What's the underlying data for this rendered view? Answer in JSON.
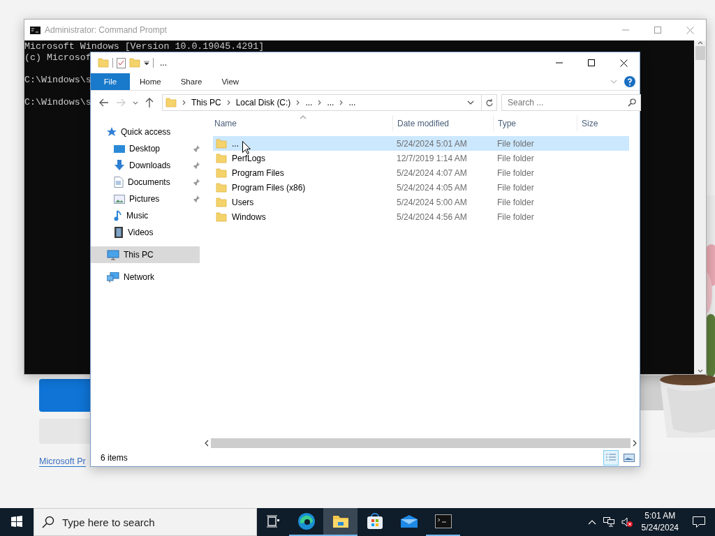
{
  "desktop": {
    "link": "Microsoft Pr"
  },
  "cmd_window": {
    "title": "Administrator: Command Prompt",
    "active": false,
    "lines": [
      {
        "text": "Microsoft Windows [Version 10.0.19045.4291]",
        "blank_before": false
      },
      {
        "text": "(c) Microsof",
        "blank_before": false
      },
      {
        "text": "C:\\Windows\\s",
        "blank_before": true
      },
      {
        "text": "C:\\Windows\\s",
        "blank_before": true
      }
    ]
  },
  "explorer": {
    "active": true,
    "quick_access_toolbar": {
      "text": "..."
    },
    "ribbon_tabs": [
      {
        "label": "File",
        "kind": "menu",
        "selected": false
      },
      {
        "label": "Home",
        "kind": "tab",
        "selected": false
      },
      {
        "label": "Share",
        "kind": "tab",
        "selected": false
      },
      {
        "label": "View",
        "kind": "tab",
        "selected": false
      }
    ],
    "address": {
      "segments": [
        "This PC",
        "Local Disk (C:)",
        "...",
        "...",
        "..."
      ]
    },
    "search": {
      "placeholder": "Search ..."
    },
    "nav": [
      {
        "label": "Quick access",
        "kind": "star",
        "selected": false,
        "pinned": false,
        "children": [
          {
            "label": "Desktop",
            "kind": "desktop",
            "selected": false,
            "pinned": true
          },
          {
            "label": "Downloads",
            "kind": "downloads",
            "selected": false,
            "pinned": true
          },
          {
            "label": "Documents",
            "kind": "documents",
            "selected": false,
            "pinned": true
          },
          {
            "label": "Pictures",
            "kind": "pictures",
            "selected": false,
            "pinned": true
          },
          {
            "label": "Music",
            "kind": "music",
            "selected": false,
            "pinned": false
          },
          {
            "label": "Videos",
            "kind": "videos",
            "selected": false,
            "pinned": false
          }
        ]
      },
      {
        "label": "This PC",
        "kind": "pc",
        "selected": true,
        "pinned": false
      },
      {
        "label": "Network",
        "kind": "network",
        "selected": false,
        "pinned": false
      }
    ],
    "columns": [
      {
        "label": "Name",
        "sorted": true
      },
      {
        "label": "Date modified",
        "sorted": false
      },
      {
        "label": "Type",
        "sorted": false
      },
      {
        "label": "Size",
        "sorted": false
      }
    ],
    "rows": [
      {
        "name": "...",
        "date": "5/24/2024 5:01 AM",
        "type": "File folder",
        "selected": true
      },
      {
        "name": "PerfLogs",
        "date": "12/7/2019 1:14 AM",
        "type": "File folder",
        "selected": false
      },
      {
        "name": "Program Files",
        "date": "5/24/2024 4:07 AM",
        "type": "File folder",
        "selected": false
      },
      {
        "name": "Program Files (x86)",
        "date": "5/24/2024 4:05 AM",
        "type": "File folder",
        "selected": false
      },
      {
        "name": "Users",
        "date": "5/24/2024 5:00 AM",
        "type": "File folder",
        "selected": false
      },
      {
        "name": "Windows",
        "date": "5/24/2024 4:56 AM",
        "type": "File folder",
        "selected": false
      }
    ],
    "status": "6 items",
    "views": [
      {
        "kind": "details",
        "selected": true
      },
      {
        "kind": "large-icons",
        "selected": false
      }
    ]
  },
  "taskbar": {
    "search": {
      "placeholder": "Type here to search"
    },
    "apps": [
      {
        "kind": "task-view",
        "running": false,
        "active": false
      },
      {
        "kind": "edge",
        "running": true,
        "active": false
      },
      {
        "kind": "explorer",
        "running": true,
        "active": true
      },
      {
        "kind": "store",
        "running": false,
        "active": false
      },
      {
        "kind": "mail",
        "running": false,
        "active": false
      },
      {
        "kind": "cmd",
        "running": true,
        "active": false
      }
    ],
    "time": "5:01 AM",
    "date": "5/24/2024"
  }
}
